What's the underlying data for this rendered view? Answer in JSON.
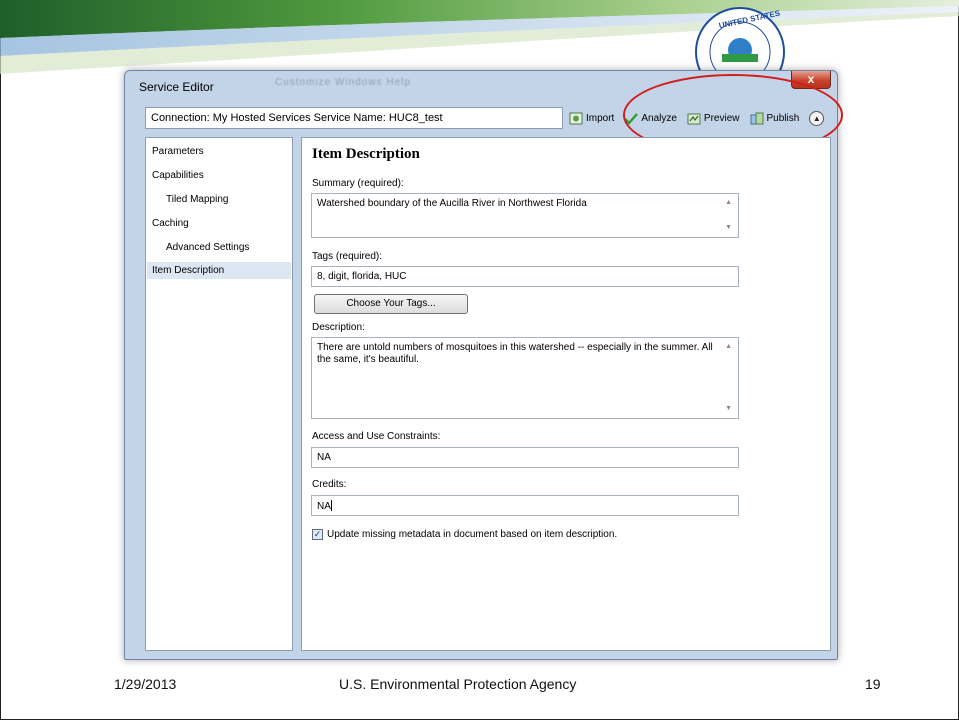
{
  "window": {
    "title": "Service Editor",
    "menu_ghost": "Customize   Windows   Help",
    "close_label": "x"
  },
  "connection": {
    "text": "Connection: My Hosted Services  Service Name: HUC8_test"
  },
  "toolbar": {
    "import_label": "Import",
    "analyze_label": "Analyze",
    "preview_label": "Preview",
    "publish_label": "Publish"
  },
  "nav": {
    "items": [
      {
        "label": "Parameters"
      },
      {
        "label": "Capabilities"
      },
      {
        "label": "Tiled Mapping"
      },
      {
        "label": "Caching"
      },
      {
        "label": "Advanced Settings"
      },
      {
        "label": "Item Description"
      }
    ],
    "selected": "Item Description"
  },
  "item_description": {
    "heading": "Item Description",
    "summary_label": "Summary (required):",
    "summary_value": "Watershed boundary of the Aucilla River in Northwest Florida",
    "tags_label": "Tags (required):",
    "tags_value": "8, digit, florida, HUC",
    "choose_tags_label": "Choose Your Tags...",
    "description_label": "Description:",
    "description_value": "There are untold numbers of mosquitoes in this watershed -- especially in the summer. All the same, it's beautiful.",
    "access_label": "Access and Use Constraints:",
    "access_value": "NA",
    "credits_label": "Credits:",
    "credits_value": "NA",
    "update_metadata_label": "Update missing metadata in document based on item description.",
    "update_metadata_checked": true
  },
  "slide": {
    "date": "1/29/2013",
    "agency": "U.S. Environmental Protection Agency",
    "page": "19",
    "seal_text": "UNITED STATES"
  },
  "colors": {
    "highlight": "#d41c1c",
    "swoosh_green": "#3f8c3a",
    "window_frame": "#c3d4e8"
  }
}
